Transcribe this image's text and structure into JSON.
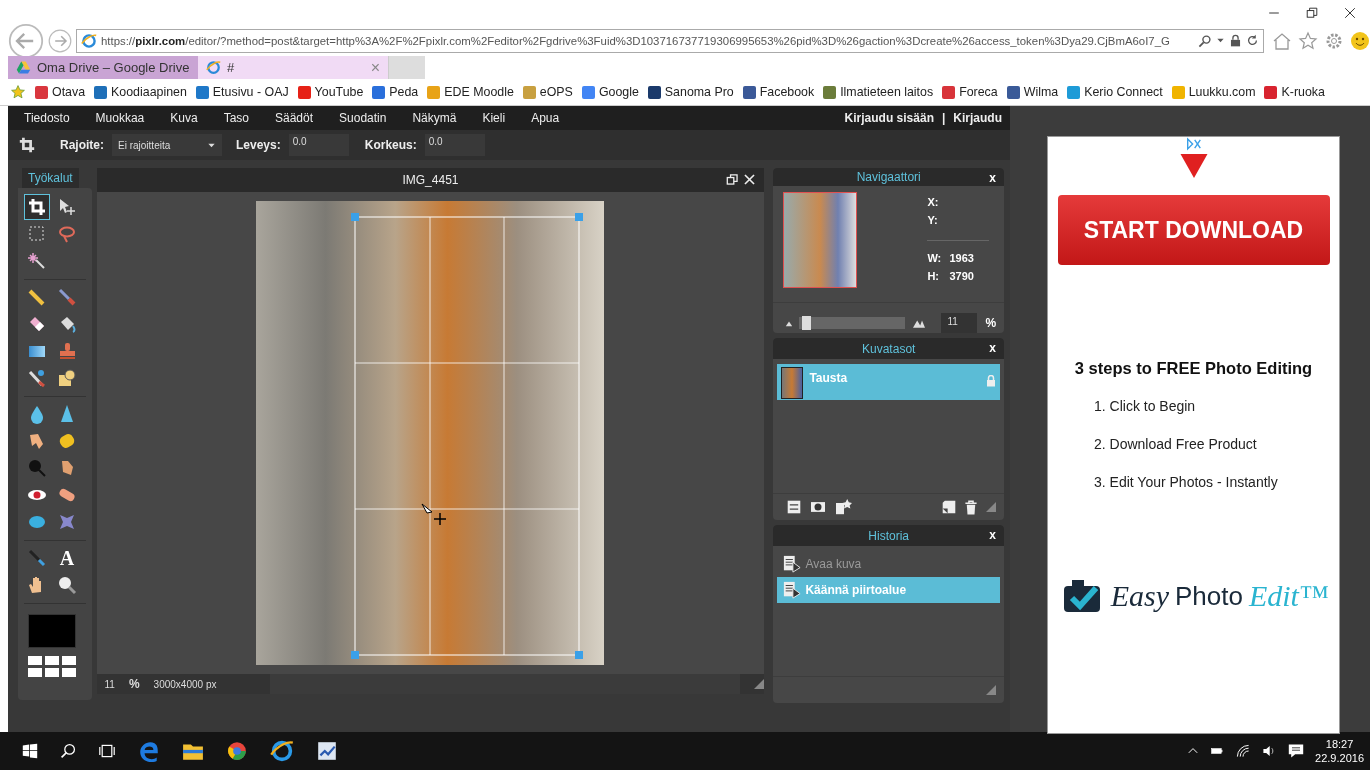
{
  "browser": {
    "url": "https://pixlr.com/editor/?method=post&target=http%3A%2F%2Fpixlr.com%2Feditor%2Fgdrive%3Fuid%3D103716737719306995653%26pid%3D%26gaction%3Dcreate%26access_token%3Dya29.CjBmA6oI7_G",
    "tabs": [
      {
        "title": "Oma Drive – Google Drive",
        "selected": false
      },
      {
        "title": "#",
        "selected": true,
        "close": "×"
      }
    ],
    "favorites": [
      {
        "label": "Otava",
        "color": "#d9363e"
      },
      {
        "label": "Koodiaapinen",
        "color": "#1e6fb8"
      },
      {
        "label": "Etusivu - OAJ",
        "color": "#1f78c8"
      },
      {
        "label": "YouTube",
        "color": "#e62117"
      },
      {
        "label": "Peda",
        "color": "#2a6fdb"
      },
      {
        "label": "EDE Moodle",
        "color": "#e8a317"
      },
      {
        "label": "eOPS",
        "color": "#c8a040"
      },
      {
        "label": "Google",
        "color": "#4285f4"
      },
      {
        "label": "Sanoma Pro",
        "color": "#1b3a6b"
      },
      {
        "label": "Facebook",
        "color": "#3b5998"
      },
      {
        "label": "Ilmatieteen laitos",
        "color": "#6b7c3a"
      },
      {
        "label": "Foreca",
        "color": "#d8343a"
      },
      {
        "label": "Wilma",
        "color": "#3a5a98"
      },
      {
        "label": "Kerio Connect",
        "color": "#1e9bd7"
      },
      {
        "label": "Luukku.com",
        "color": "#f0b400"
      },
      {
        "label": "K-ruoka",
        "color": "#d8242f"
      }
    ]
  },
  "menu": [
    "Tiedosto",
    "Muokkaa",
    "Kuva",
    "Taso",
    "Säädöt",
    "Suodatin",
    "Näkymä",
    "Kieli",
    "Apua"
  ],
  "account": {
    "login": "Kirjaudu sisään",
    "separator": "|",
    "register": "Kirjaudu"
  },
  "options": {
    "constraint_label": "Rajoite:",
    "constraint_value": "Ei rajoitteita",
    "width_label": "Leveys:",
    "width_value": "0.0",
    "height_label": "Korkeus:",
    "height_value": "0.0"
  },
  "tools": {
    "title": "Työkalut",
    "groups": [
      [
        {
          "kind": "crop",
          "selected": true
        },
        {
          "kind": "move",
          "selected": false
        },
        {
          "kind": "marquee",
          "selected": false
        },
        {
          "kind": "lasso",
          "selected": false
        },
        {
          "kind": "wand",
          "selected": false
        }
      ],
      [
        {
          "kind": "pencil",
          "selected": false
        },
        {
          "kind": "brush",
          "selected": false
        },
        {
          "kind": "eraser",
          "selected": false
        },
        {
          "kind": "bucket",
          "selected": false
        },
        {
          "kind": "gradient",
          "selected": false
        },
        {
          "kind": "stamp",
          "selected": false
        },
        {
          "kind": "replace",
          "selected": false
        },
        {
          "kind": "shape",
          "selected": false
        }
      ],
      [
        {
          "kind": "blur",
          "selected": false
        },
        {
          "kind": "sharpen",
          "selected": false
        },
        {
          "kind": "smudge",
          "selected": false
        },
        {
          "kind": "sponge",
          "selected": false
        },
        {
          "kind": "burn",
          "selected": false
        },
        {
          "kind": "dodge",
          "selected": false
        },
        {
          "kind": "redeye",
          "selected": false
        },
        {
          "kind": "heal",
          "selected": false
        },
        {
          "kind": "bloat",
          "selected": false
        },
        {
          "kind": "pinch",
          "selected": false
        }
      ],
      [
        {
          "kind": "picker",
          "selected": false
        },
        {
          "kind": "type",
          "selected": false,
          "label": "A"
        },
        {
          "kind": "hand",
          "selected": false
        },
        {
          "kind": "zoom",
          "selected": false
        }
      ]
    ]
  },
  "document": {
    "title": "IMG_4451",
    "zoom": "11",
    "zoom_unit": "%",
    "size": "3000x4000 px"
  },
  "navigator": {
    "title": "Navigaattori",
    "close": "x",
    "x_label": "X:",
    "y_label": "Y:",
    "w_label": "W:",
    "w_value": "1963",
    "h_label": "H:",
    "h_value": "3790",
    "level": 0.03,
    "zoom": "11",
    "zoom_unit": "%"
  },
  "layers": {
    "title": "Kuvatasot",
    "close": "x",
    "items": [
      {
        "name": "Tausta",
        "selected": true,
        "locked": true
      }
    ]
  },
  "history": {
    "title": "Historia",
    "close": "x",
    "items": [
      {
        "label": "Avaa kuva",
        "selected": false,
        "disabled": true
      },
      {
        "label": "Käännä piirtoalue",
        "selected": true,
        "disabled": false
      }
    ]
  },
  "ad": {
    "button": "START DOWNLOAD",
    "heading": "3 steps to FREE Photo Editing",
    "steps": [
      "1. Click to Begin",
      "2. Download Free Product",
      "3. Edit Your Photos - Instantly"
    ],
    "logo": [
      "Easy",
      "Photo",
      "Edit™"
    ]
  },
  "taskbar": {
    "time": "18:27",
    "date": "22.9.2016"
  }
}
